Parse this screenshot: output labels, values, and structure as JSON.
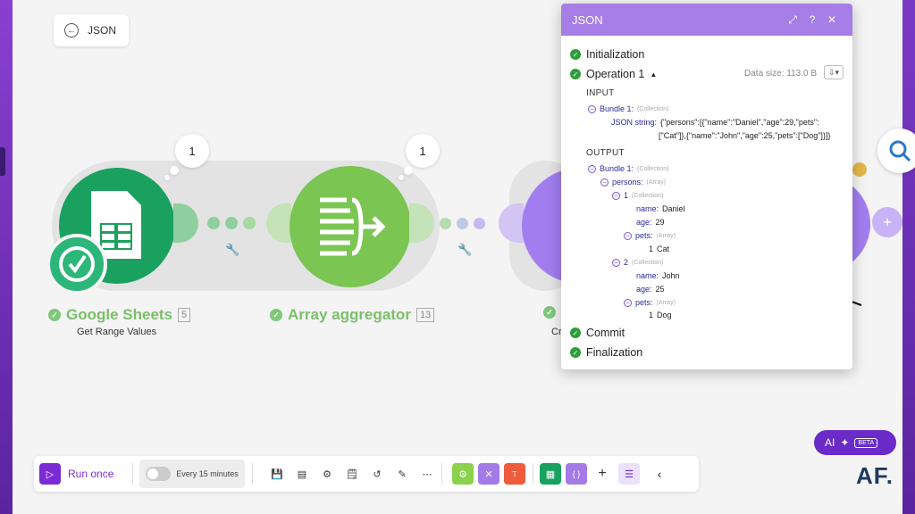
{
  "back_button": {
    "label": "JSON"
  },
  "modules": [
    {
      "name": "Google Sheets",
      "count": "5",
      "subtitle": "Get Range Values",
      "bubble": "1"
    },
    {
      "name": "Array aggregator",
      "count": "13",
      "subtitle": "",
      "bubble": "1"
    },
    {
      "name": "",
      "count": "",
      "subtitle": "Cr",
      "bubble": ""
    }
  ],
  "panel": {
    "title": "JSON",
    "items": {
      "initialization": "Initialization",
      "operation": "Operation 1",
      "commit": "Commit",
      "finalization": "Finalization"
    },
    "data_size": "Data size: 113.0 B",
    "input_label": "INPUT",
    "output_label": "OUTPUT",
    "input": {
      "bundle": "Bundle 1:",
      "bundle_type": "(Collection)",
      "json_key": "JSON string:",
      "json_val_1": "{\"persons\":[{\"name\":\"Daniel\",\"age\":29,\"pets\":",
      "json_val_2": "[\"Cat\"]},{\"name\":\"John\",\"age\":25,\"pets\":[\"Dog\"]}]}"
    },
    "output": {
      "bundle": "Bundle 1:",
      "bundle_type": "(Collection)",
      "persons_key": "persons:",
      "persons_type": "(Array)",
      "p1": "1",
      "p1_type": "(Collection)",
      "p1_name_key": "name:",
      "p1_name": "Daniel",
      "p1_age_key": "age:",
      "p1_age": "29",
      "p1_pets_key": "pets:",
      "p1_pets_type": "(Array)",
      "p1_pet_idx": "1",
      "p1_pet": "Cat",
      "p2": "2",
      "p2_type": "(Collection)",
      "p2_name_key": "name:",
      "p2_name": "John",
      "p2_age_key": "age:",
      "p2_age": "25",
      "p2_pets_key": "pets:",
      "p2_pets_type": "(Array)",
      "p2_pet_idx": "1",
      "p2_pet": "Dog"
    }
  },
  "toolbar": {
    "run_once": "Run once",
    "schedule": "Every 15 minutes"
  },
  "ai_button": {
    "label": "AI",
    "badge": "BETA"
  },
  "brand": "AF."
}
